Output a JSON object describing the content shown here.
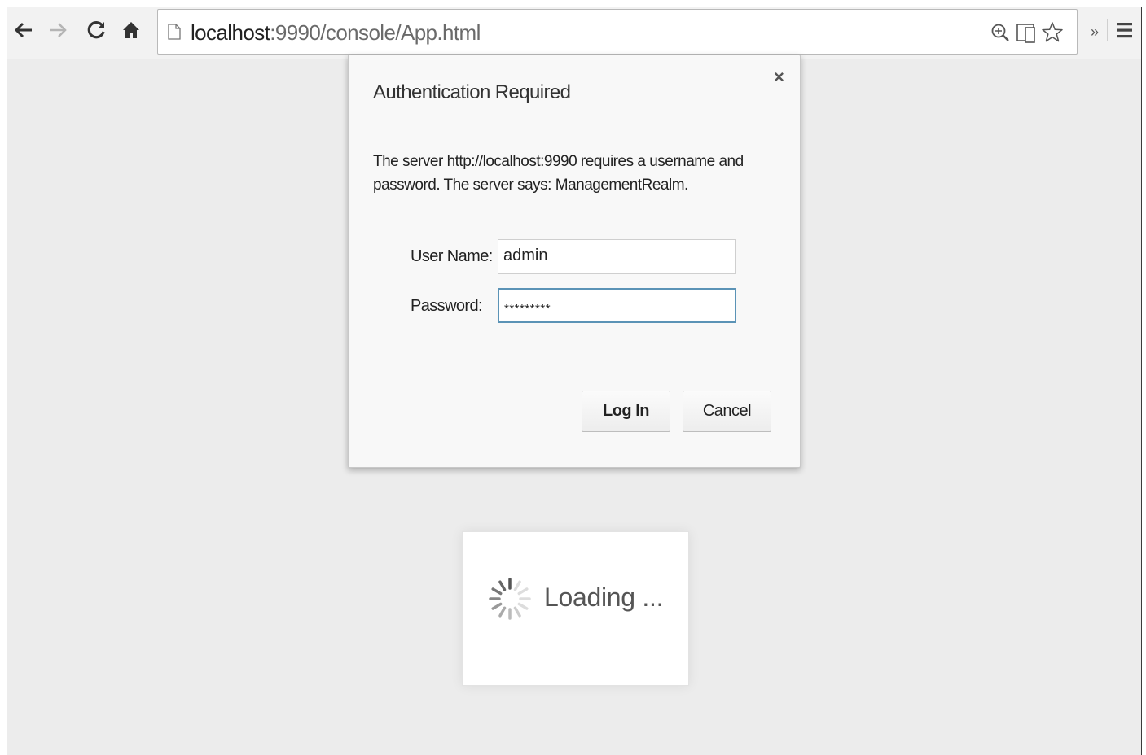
{
  "browser": {
    "url_host": "localhost",
    "url_port": ":9990",
    "url_path": "/console/App.html",
    "icons": {
      "back": "back-arrow-icon",
      "forward": "forward-arrow-icon",
      "reload": "reload-icon",
      "home": "home-icon",
      "page": "page-icon",
      "zoom": "zoom-icon",
      "device": "device-mode-icon",
      "bookmark": "star-icon",
      "overflow": "chevron-double-right-icon",
      "menu": "hamburger-menu-icon"
    },
    "overflow_label": "»"
  },
  "dialog": {
    "title": "Authentication Required",
    "close_label": "×",
    "message": "The server http://localhost:9990 requires a username and password. The server says: ManagementRealm.",
    "username_label": "User Name:",
    "username_value": "admin",
    "password_label": "Password:",
    "password_value": "*********",
    "login_label": "Log In",
    "cancel_label": "Cancel"
  },
  "loading": {
    "text": "Loading ...",
    "icon": "spinner-icon"
  },
  "colors": {
    "page_background": "#ececec",
    "toolbar_background": "#f2f2f2",
    "dialog_background": "#f8f8f8",
    "focus_border": "#5b93b6"
  }
}
